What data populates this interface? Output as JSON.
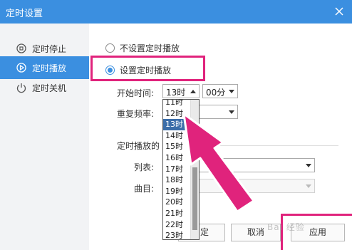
{
  "window": {
    "title": "定时设置"
  },
  "sidebar": {
    "items": [
      {
        "label": "定时停止",
        "icon": "stop-timer-icon",
        "active": false
      },
      {
        "label": "定时播放",
        "icon": "play-timer-icon",
        "active": true
      },
      {
        "label": "定时关机",
        "icon": "power-icon",
        "active": false
      }
    ]
  },
  "options": {
    "no_timer_label": "不设置定时播放",
    "timer_label": "设置定时播放",
    "selected": "timer"
  },
  "start_time": {
    "label": "开始时间:",
    "hour_value": "13时",
    "minute_value": "00分"
  },
  "repeat": {
    "label": "重复频率:"
  },
  "section_label": "定时播放的",
  "list": {
    "label": "列表:"
  },
  "track": {
    "label": "曲目:"
  },
  "hour_dropdown": {
    "items": [
      "11时",
      "12时",
      "13时",
      "14时",
      "15时",
      "16时",
      "17时",
      "18时",
      "19时",
      "20时",
      "21时",
      "22时",
      "23时"
    ],
    "selected": "13时"
  },
  "buttons": {
    "ok": "定",
    "cancel": "取消",
    "apply": "应用"
  },
  "watermark": "Bai 经验",
  "colors": {
    "accent": "#3b8fe0",
    "highlight": "#e0237c",
    "selected_row": "#3c6ea9"
  }
}
